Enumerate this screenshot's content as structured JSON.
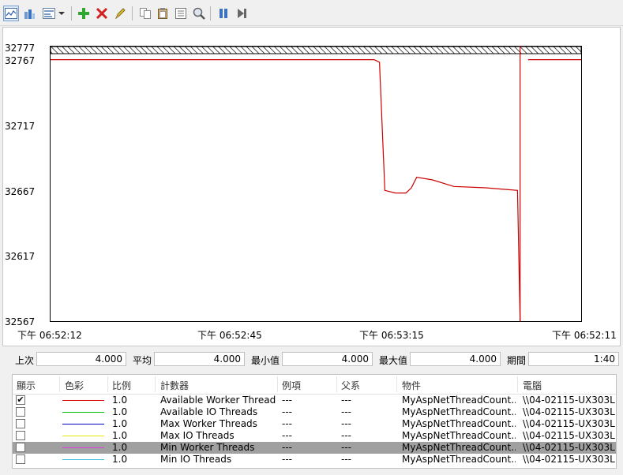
{
  "toolbar": {
    "buttons": [
      {
        "name": "view-graph-icon"
      },
      {
        "name": "view-histogram-icon"
      },
      {
        "name": "change-graph-type-icon"
      },
      {
        "name": "dropdown-arrow-icon"
      },
      {
        "name": "add-counter-icon"
      },
      {
        "name": "delete-counter-icon"
      },
      {
        "name": "highlight-icon"
      },
      {
        "name": "copy-properties-icon"
      },
      {
        "name": "paste-counter-list-icon"
      },
      {
        "name": "properties-icon"
      },
      {
        "name": "zoom-icon"
      },
      {
        "name": "freeze-display-icon"
      },
      {
        "name": "update-data-icon"
      }
    ]
  },
  "chart_data": {
    "type": "line",
    "ylim": [
      32567,
      32777
    ],
    "y_ticks": [
      "32777",
      "32767",
      "32717",
      "32667",
      "32617",
      "32567"
    ],
    "x_ticks": [
      "下午 06:52:12",
      "下午 06:52:45",
      "下午 06:53:15",
      "下午 06:52:11"
    ],
    "duration_seconds": 100,
    "series": [
      {
        "name": "Available Worker Threads",
        "color": "#cc0000",
        "segments": [
          [
            [
              0,
              32767
            ],
            [
              61,
              32767
            ],
            [
              62,
              32765
            ],
            [
              63,
              32667
            ],
            [
              65,
              32665
            ],
            [
              67,
              32665
            ],
            [
              68,
              32669
            ],
            [
              69,
              32677
            ],
            [
              72,
              32675
            ],
            [
              76,
              32670
            ],
            [
              82,
              32669
            ],
            [
              88,
              32667
            ],
            [
              88.5,
              32567
            ]
          ],
          [
            [
              88.5,
              32785
            ]
          ],
          [
            [
              90,
              32767
            ],
            [
              100,
              32767
            ]
          ]
        ]
      }
    ]
  },
  "stats": {
    "last_label": "上次",
    "last_value": "4.000",
    "avg_label": "平均",
    "avg_value": "4.000",
    "min_label": "最小值",
    "min_value": "4.000",
    "max_label": "最大值",
    "max_value": "4.000",
    "duration_label": "期間",
    "duration_value": "1:40"
  },
  "legend": {
    "headers": {
      "show": "顯示",
      "color": "色彩",
      "scale": "比例",
      "counter": "計數器",
      "instance": "例項",
      "parent": "父系",
      "object": "物件",
      "computer": "電腦"
    },
    "rows": [
      {
        "checked": true,
        "color": "#e00000",
        "scale": "1.0",
        "counter": "Available Worker Threads",
        "instance": "---",
        "parent": "---",
        "object": "MyAspNetThreadCount...",
        "computer": "\\\\04-02115-UX303L",
        "selected": false
      },
      {
        "checked": false,
        "color": "#00c000",
        "scale": "1.0",
        "counter": "Available IO Threads",
        "instance": "---",
        "parent": "---",
        "object": "MyAspNetThreadCount...",
        "computer": "\\\\04-02115-UX303L",
        "selected": false
      },
      {
        "checked": false,
        "color": "#0000c0",
        "scale": "1.0",
        "counter": "Max Worker Threads",
        "instance": "---",
        "parent": "---",
        "object": "MyAspNetThreadCount...",
        "computer": "\\\\04-02115-UX303L",
        "selected": false
      },
      {
        "checked": false,
        "color": "#e8e800",
        "scale": "1.0",
        "counter": "Max IO Threads",
        "instance": "---",
        "parent": "---",
        "object": "MyAspNetThreadCount...",
        "computer": "\\\\04-02115-UX303L",
        "selected": false
      },
      {
        "checked": false,
        "color": "#e040e0",
        "scale": "1.0",
        "counter": "Min Worker Threads",
        "instance": "---",
        "parent": "---",
        "object": "MyAspNetThreadCount...",
        "computer": "\\\\04-02115-UX303L",
        "selected": true
      },
      {
        "checked": false,
        "color": "#40c0e0",
        "scale": "1.0",
        "counter": "Min IO Threads",
        "instance": "---",
        "parent": "---",
        "object": "MyAspNetThreadCount...",
        "computer": "\\\\04-02115-UX303L",
        "selected": false
      }
    ]
  }
}
